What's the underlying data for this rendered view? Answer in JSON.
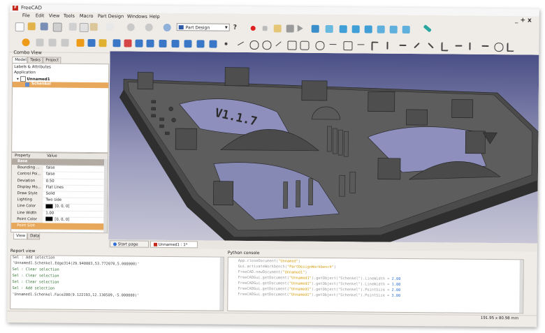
{
  "app": {
    "title": "FreeCAD",
    "logo_letter": "F"
  },
  "menu": [
    "File",
    "Edit",
    "View",
    "Tools",
    "Macro",
    "Part Design",
    "Windows",
    "Help"
  ],
  "window_controls": "_+x",
  "toolbar": {
    "workbench": "Part Design"
  },
  "combo_view": {
    "title": "Combo View",
    "tabs": [
      "Model",
      "Tasks",
      "Project"
    ],
    "tree_header": "Labels & Attributes",
    "tree": {
      "group": "Application",
      "doc": "Unnamed1",
      "object": "Schenkel"
    }
  },
  "properties": {
    "headers": [
      "Property",
      "Value"
    ],
    "group": "Base",
    "rows": [
      {
        "key": "Bounding ...",
        "value": "false"
      },
      {
        "key": "Control Poi...",
        "value": "false"
      },
      {
        "key": "Deviation",
        "value": "0.50"
      },
      {
        "key": "Display Mo...",
        "value": "Flat Lines"
      },
      {
        "key": "Draw Style",
        "value": "Solid"
      },
      {
        "key": "Lighting",
        "value": "Two side"
      },
      {
        "key": "Line Color",
        "value": "[0, 0, 0]"
      },
      {
        "key": "Line Width",
        "value": "1.00"
      },
      {
        "key": "Point Color",
        "value": "[0, 0, 0]"
      },
      {
        "key": "Point Size",
        "value": ""
      }
    ],
    "bottom_tabs": [
      "View",
      "Data"
    ]
  },
  "doc_tabs": [
    "Start page",
    "Unnamed1 : 1*"
  ],
  "viewport": {
    "model_text": "V1.1.7"
  },
  "report_view": {
    "title": "Report view",
    "lines": [
      "Sel : Add selection",
      "'Unnamed1.Schenkel.Edge314(29.940883,53.772070,5.000000)'",
      "Sel : Clear selection",
      "Sel : Clear selection",
      "Sel : Clear selection",
      "Sel : Add selection",
      "'Unnamed1.Schenkel.Face280(9.122193,12.130509,-5.000000)'"
    ]
  },
  "python_console": {
    "title": "Python console",
    "lines": [
      {
        "a": "App.closeDocument(",
        "s": "\"Unnamed\"",
        "b": ")",
        "n": ""
      },
      {
        "a": "Gui.activateWorkbench(",
        "s": "\"PartDesignWorkbench\"",
        "b": ")",
        "n": ""
      },
      {
        "a": "FreeCAD.newDocument(",
        "s": "\"Unnamed1\"",
        "b": ")",
        "n": ""
      },
      {
        "a": "FreeCADGui.getDocument(",
        "s": "\"Unnamed1\"",
        "b": ").getObject(\"Schenkel\").LineWidth = ",
        "n": "2.00"
      },
      {
        "a": "FreeCADGui.getDocument(",
        "s": "\"Unnamed1\"",
        "b": ").getObject(\"Schenkel\").LineWidth = ",
        "n": "1.00"
      },
      {
        "a": "FreeCADGui.getDocument(",
        "s": "\"Unnamed1\"",
        "b": ").getObject(\"Schenkel\").PointSize = ",
        "n": "2.00"
      },
      {
        "a": "FreeCADGui.getDocument(",
        "s": "\"Unnamed1\"",
        "b": ").getObject(\"Schenkel\").PointSize = ",
        "n": "3.00"
      }
    ]
  },
  "status_bar": {
    "dimensions": "191.95 x 80.98 mm"
  },
  "colors": {
    "accent": "#e8a85b",
    "viewport_top": "#4a4f86",
    "viewport_bottom": "#c7c6d6",
    "model": "#5a5a5a"
  }
}
